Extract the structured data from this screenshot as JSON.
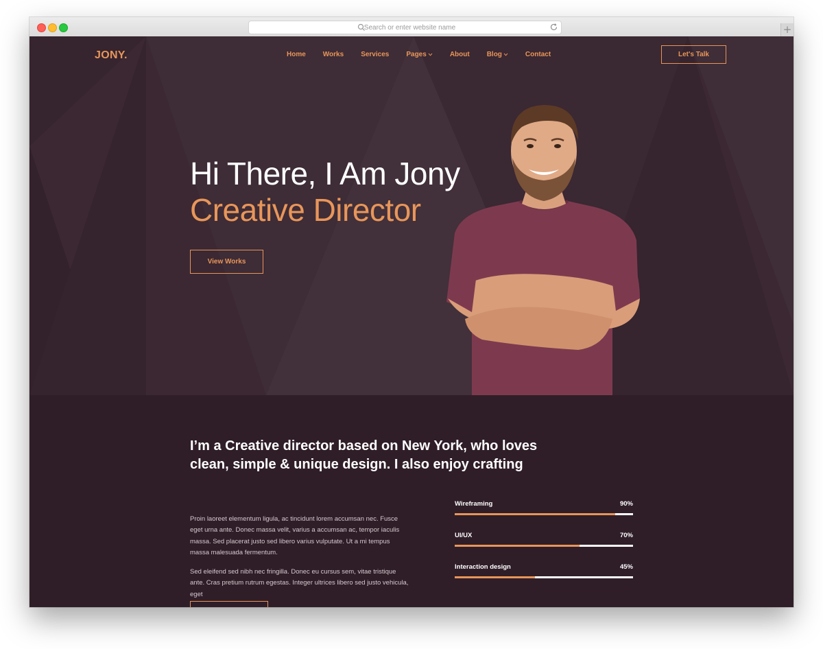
{
  "browser": {
    "url_placeholder": "Search or enter website name",
    "new_tab": "+"
  },
  "site": {
    "logo": "JONY.",
    "nav": [
      {
        "label": "Home",
        "dropdown": false
      },
      {
        "label": "Works",
        "dropdown": false
      },
      {
        "label": "Services",
        "dropdown": false
      },
      {
        "label": "Pages",
        "dropdown": true
      },
      {
        "label": "About",
        "dropdown": false
      },
      {
        "label": "Blog",
        "dropdown": true
      },
      {
        "label": "Contact",
        "dropdown": false
      }
    ],
    "cta": "Let's Talk"
  },
  "hero": {
    "title": "Hi There, I Am Jony",
    "subtitle": "Creative Director",
    "button": "View Works"
  },
  "about": {
    "heading": "I’m a Creative director based on New York, who loves clean, simple & unique design. I also enjoy crafting",
    "paragraphs": [
      "Proin laoreet elementum ligula, ac tincidunt lorem accumsan nec. Fusce eget urna ante. Donec massa velit, varius a accumsan ac, tempor iaculis massa. Sed placerat justo sed libero varius vulputate. Ut a mi tempus massa malesuada fermentum.",
      "Sed eleifend sed nibh nec fringilla. Donec eu cursus sem, vitae tristique ante. Cras pretium rutrum egestas. Integer ultrices libero sed justo vehicula, eget"
    ],
    "skills": [
      {
        "name": "Wireframing",
        "percent_label": "90%",
        "value": 90
      },
      {
        "name": "UI/UX",
        "percent_label": "70%",
        "value": 70
      },
      {
        "name": "Interaction design",
        "percent_label": "45%",
        "value": 45
      }
    ]
  },
  "colors": {
    "accent": "#e8965a",
    "hero_bg": "#3b2832",
    "section_bg": "#2f1e28"
  }
}
